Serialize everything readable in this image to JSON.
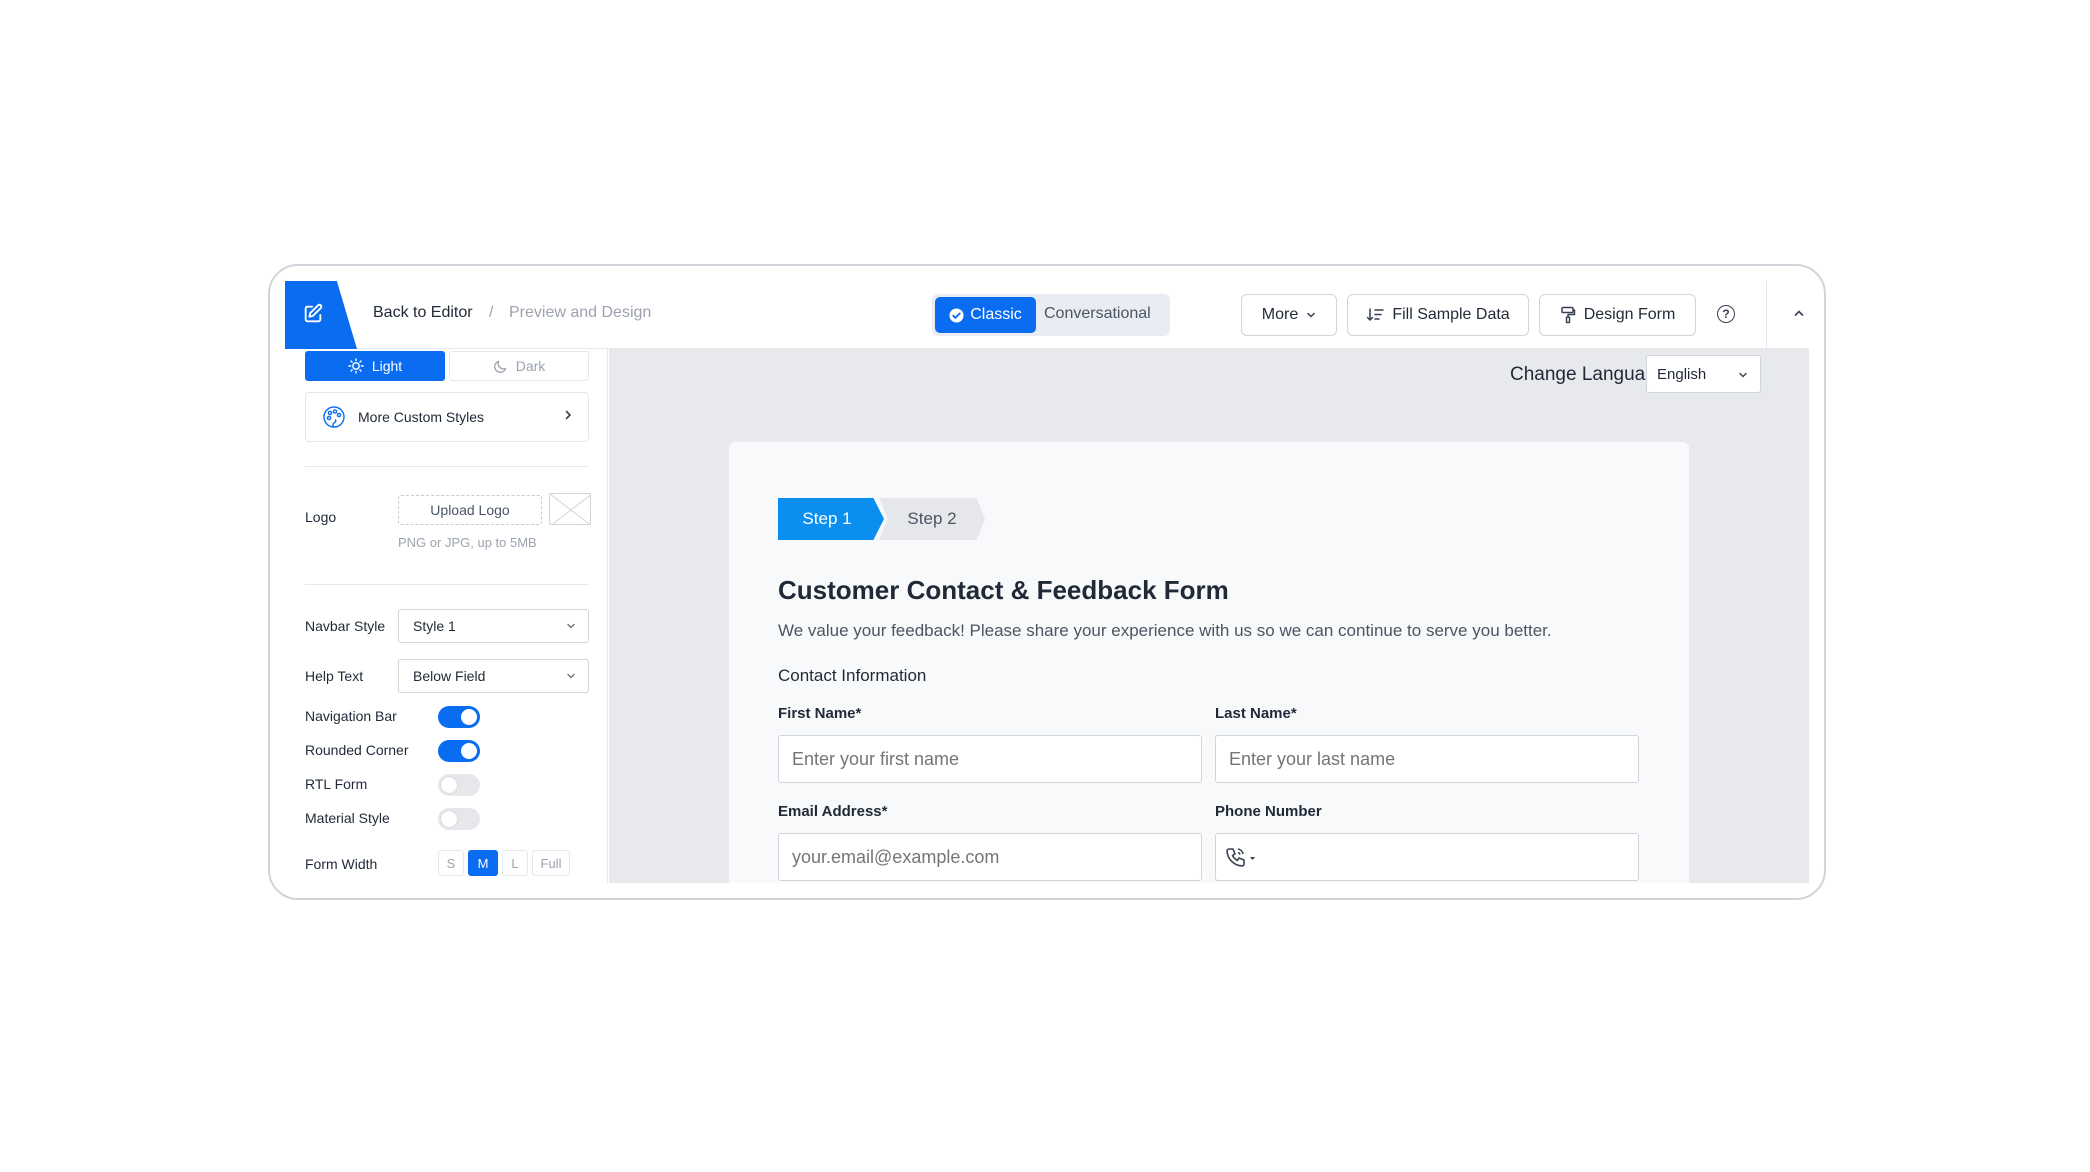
{
  "topbar": {
    "back_label": "Back to Editor",
    "separator": "/",
    "current_label": "Preview and Design",
    "mode": {
      "classic": "Classic",
      "conversational": "Conversational"
    },
    "more_label": "More",
    "fill_sample_label": "Fill Sample Data",
    "design_form_label": "Design Form",
    "help_glyph": "?"
  },
  "sidebar": {
    "theme": {
      "light": "Light",
      "dark": "Dark",
      "selected": "Light"
    },
    "more_custom_styles": "More Custom Styles",
    "logo": {
      "label": "Logo",
      "upload_label": "Upload Logo",
      "hint": "PNG or JPG, up to 5MB"
    },
    "navbar_style": {
      "label": "Navbar Style",
      "value": "Style 1"
    },
    "help_text": {
      "label": "Help Text",
      "value": "Below Field"
    },
    "toggles": [
      {
        "label": "Navigation Bar",
        "on": true
      },
      {
        "label": "Rounded Corner",
        "on": true
      },
      {
        "label": "RTL Form",
        "on": false
      },
      {
        "label": "Material Style",
        "on": false
      }
    ],
    "form_width": {
      "label": "Form Width",
      "options": [
        "S",
        "M",
        "L",
        "Full"
      ],
      "selected": "M"
    }
  },
  "main": {
    "change_language_label": "Change Language",
    "language_value": "English",
    "steps": [
      "Step 1",
      "Step 2"
    ],
    "form": {
      "title": "Customer Contact & Feedback Form",
      "description": "We value your feedback! Please share your experience with us so we can continue to serve you better.",
      "section": "Contact Information",
      "fields": {
        "first_name": {
          "label": "First Name*",
          "placeholder": "Enter your first name"
        },
        "last_name": {
          "label": "Last Name*",
          "placeholder": "Enter your last name"
        },
        "email": {
          "label": "Email Address*",
          "placeholder": "your.email@example.com"
        },
        "phone": {
          "label": "Phone Number"
        }
      }
    }
  },
  "colors": {
    "accent": "#0a6cf1",
    "step_active": "#0a8ff1",
    "canvas": "#e7e9ec"
  },
  "icons": {
    "logo": "edit-icon",
    "classic": "check-circle-icon",
    "more": "chevron-down-icon",
    "fill": "sort-lines-icon",
    "design": "paint-roller-icon",
    "help": "question-circle-icon",
    "collapse": "chevron-up-icon",
    "light": "sun-icon",
    "dark": "moon-icon",
    "custom_styles": "palette-icon",
    "phone": "phone-icon"
  }
}
